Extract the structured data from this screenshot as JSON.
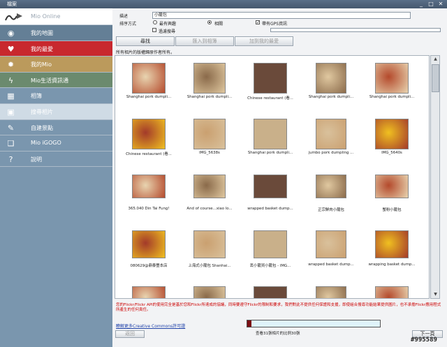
{
  "window": {
    "title": "檔案",
    "controls": [
      "_",
      "□",
      "✕"
    ]
  },
  "sidebar": {
    "header": {
      "label": "Mio Online"
    },
    "items": [
      {
        "label": "我的地圖",
        "icon": "eye-icon",
        "bg": "#647f96"
      },
      {
        "label": "我的最愛",
        "icon": "heart-icon",
        "bg": "#c8282e"
      },
      {
        "label": "我的Mio",
        "icon": "gear-icon",
        "bg": "#bb9a5c"
      },
      {
        "label": "Mio生活資訊通",
        "icon": "lightning-icon",
        "bg": "#6b8a6e"
      },
      {
        "label": "相簿",
        "icon": "photo-album-icon",
        "bg": "#7a96ae"
      },
      {
        "label": "搜尋相片",
        "icon": "camera-icon",
        "bg": "#cfdbe5"
      },
      {
        "label": "自建景點",
        "icon": "pen-icon",
        "bg": "#7a96ae"
      },
      {
        "label": "Mio iGOGO",
        "icon": "book-icon",
        "bg": "#7a96ae"
      },
      {
        "label": "說明",
        "icon": "question-icon",
        "bg": "#7a96ae"
      }
    ]
  },
  "form": {
    "desc_label": "描述",
    "desc_value": "小籠包",
    "sort_label": "排序方式",
    "sort_options": [
      "最有興趣",
      "相關"
    ],
    "gps_label": "帶有GPS資訊",
    "filter_label": "過濾搜尋",
    "search_button": "尋找",
    "import_button": "匯入到相簿",
    "favorite_button": "加到我的最愛",
    "hint": "所有相片的版權歸原作者所有。"
  },
  "photos": [
    "Shanghai pork dumpli...",
    "Shanghai pork dumpli...",
    "Chinese restaurant (看...",
    "Shanghai pork dumpli...",
    "Shanghai pork dumpli...",
    "Chinese restaurant (看...",
    "IMG_5638s",
    "Shanghai pork dumpli...",
    "jumbo pork dumpling ...",
    "IMG_5640s",
    "365.040 Din Tai Fung!",
    "And of course...xiao lo...",
    "wrapped basket dump...",
    "正宗鮮肉小籠包",
    "蟹粉小籠包",
    "080629@鼎泰豐本店",
    "上海式小籠包 Shanhai...",
    "丟小籠買小籠包 - IMG...",
    "wrapped basket dump...",
    "wrapping basket dump...",
    "",
    "",
    "",
    "",
    ""
  ],
  "disclaimer": "您的Flickr/Flickr API的使用完全是基於您和Flickr所達成的協議，同時要遵守Flickr的限制和要求，我們對此不提供任何保證和支援，即使組合搜尋功能結果提供圖片，也不承擔Flickr應用程式所產生的任何責任。",
  "cc_link": "瞭解更多Creative Commons許可證",
  "progress": {
    "fraction": 0.03,
    "label": "查看31張相片的比例30張"
  },
  "back_button": "返回",
  "next_button": "下一頁",
  "watermark": "#995589"
}
